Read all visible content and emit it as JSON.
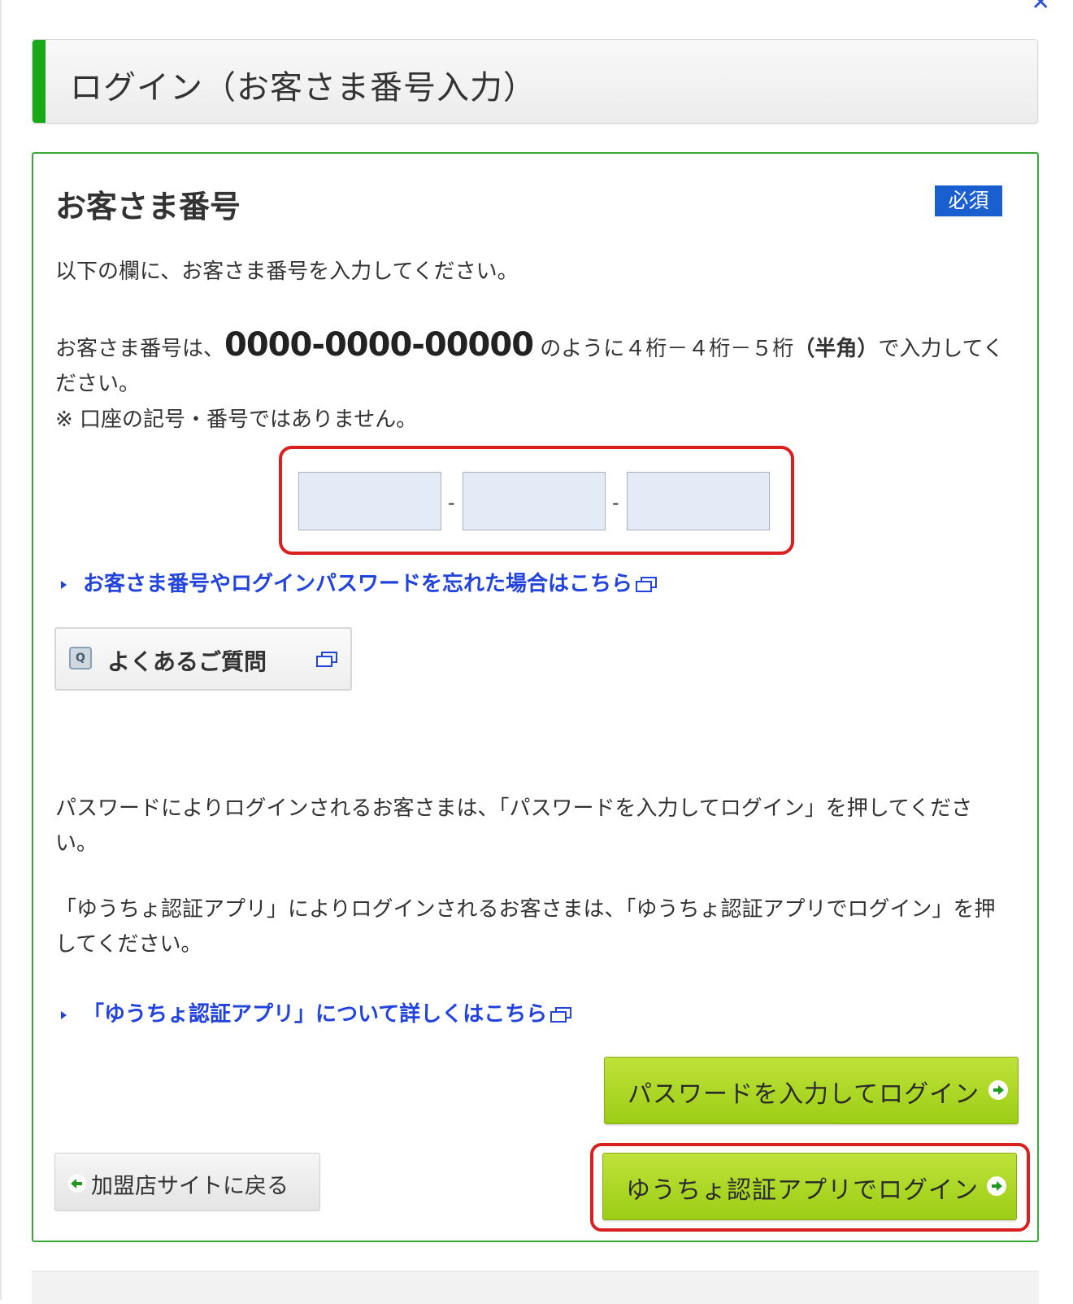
{
  "header": {
    "title": "ログイン（お客さま番号入力）"
  },
  "panel": {
    "section_title": "お客さま番号",
    "required_badge": "必須",
    "instruction": "以下の欄に、お客さま番号を入力してください。",
    "format_prefix": "お客さま番号は、",
    "format_number": "0000-0000-00000",
    "format_middle": " のように４桁－４桁－５桁",
    "format_bold": "（半角）",
    "format_suffix": "で入力してください。",
    "note": "※ 口座の記号・番号ではありません。",
    "inputs": [
      {
        "value": "",
        "placeholder": ""
      },
      {
        "value": "",
        "placeholder": ""
      },
      {
        "value": "",
        "placeholder": ""
      }
    ],
    "separator": "-",
    "forgot_link": "お客さま番号やログインパスワードを忘れた場合はこちら",
    "faq_label": "よくあるご質問",
    "faq_icon_char": "Q",
    "password_note": "パスワードによりログインされるお客さまは、「パスワードを入力してログイン」を押してください。",
    "app_note": "「ゆうちょ認証アプリ」によりログインされるお客さまは、「ゆうちょ認証アプリでログイン」を押してください。",
    "app_link": "「ゆうちょ認証アプリ」について詳しくはこちら",
    "password_login_button": "パスワードを入力してログイン",
    "app_login_button": "ゆうちょ認証アプリでログイン",
    "back_button": "加盟店サイトに戻る"
  },
  "icons": {
    "new_window": "new-window-icon",
    "faq": "question-icon",
    "arrow_right": "arrow-right-circle-icon",
    "arrow_left": "arrow-left-circle-icon"
  },
  "colors": {
    "accent_green": "#18a818",
    "panel_border": "#3aa83a",
    "badge_blue": "#1a5fd0",
    "link_blue": "#2244dd",
    "button_green": "#a8d620",
    "highlight_red": "#d9201e",
    "input_bg": "#e3ebf7"
  }
}
